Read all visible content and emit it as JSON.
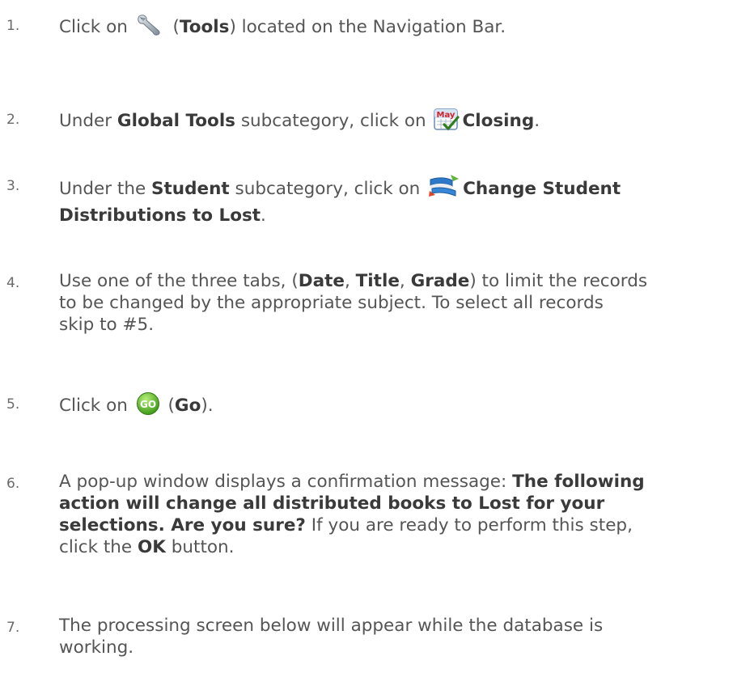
{
  "steps": [
    {
      "num": "1.",
      "parts": {
        "t1": "Click on ",
        "icon": "wrench-icon",
        "t2": " (",
        "b1": "Tools",
        "t3": ") located on the Navigation Bar."
      }
    },
    {
      "num": "2.",
      "parts": {
        "t1": "Under ",
        "b1": "Global Tools",
        "t2": " subcategory, click on ",
        "icon": "calendar-may-icon",
        "icon_text": "May",
        "b2": "Closing",
        "t3": "."
      }
    },
    {
      "num": "3.",
      "parts": {
        "t1": "Under the ",
        "b1": "Student",
        "t2": " subcategory, click on ",
        "icon": "books-exchange-icon",
        "b2": "Change Student",
        "b3": "Distributions to Lost",
        "t3": "."
      }
    },
    {
      "num": "4.",
      "parts": {
        "t1": "Use one of the three tabs, (",
        "b1": "Date",
        "t2": ", ",
        "b2": "Title",
        "t3": ", ",
        "b3": "Grade",
        "t4": ") to limit the records",
        "l2": "to be changed by the appropriate subject.  To select all records",
        "l3": "skip to #5."
      }
    },
    {
      "num": "5.",
      "parts": {
        "t1": "Click on ",
        "icon": "go-button-icon",
        "icon_text": "GO",
        "t2": " (",
        "b1": "Go",
        "t3": ")."
      }
    },
    {
      "num": "6.",
      "parts": {
        "t1": "A pop-up window displays a confirmation message: ",
        "b1": "The following",
        "b2": "action will change all distributed books to Lost for your",
        "b3": "selections.  Are you sure?",
        "t2": "  If you are ready to perform this step,",
        "t3": "click the ",
        "b4": "OK",
        "t4": " button."
      }
    },
    {
      "num": "7.",
      "parts": {
        "l1": "The processing screen below will appear while the database is",
        "l2": "working."
      }
    }
  ],
  "colors": {
    "text": "#555555",
    "bold": "#3a3a3a",
    "go_green": "#5fb82a"
  }
}
